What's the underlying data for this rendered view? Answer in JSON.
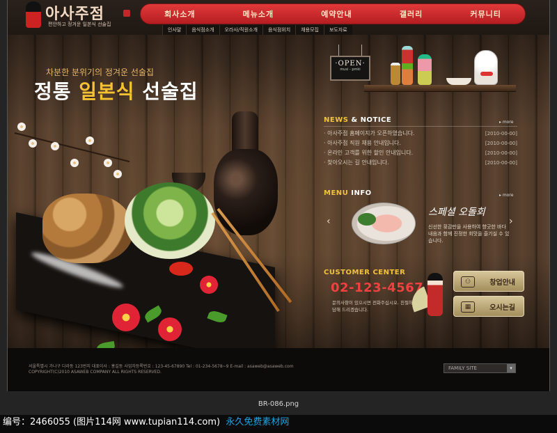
{
  "viewer": {
    "filename": "BR-086.png",
    "watermark_id": "编号：2466055 (图片114网 www.tupian114.com)",
    "watermark_tag": "永久免费素材网"
  },
  "logo": {
    "title": "아사주점",
    "subtitle": "편안하고 정겨운 일본식 선술집"
  },
  "nav": {
    "main": [
      "회사소개",
      "메뉴소개",
      "예약안내",
      "갤러리",
      "커뮤니티"
    ],
    "sub": [
      "인사말",
      "음식점소개",
      "오라사/직원소개",
      "음식점위치",
      "채용모집",
      "보도자료"
    ]
  },
  "hero": {
    "tagline": "차분한 분위기의 정겨운 선술집",
    "title_pre": "정통 ",
    "title_highlight": "일본식",
    "title_post": " 선술집"
  },
  "sign": {
    "main": "·OPEN·",
    "sub": "musi - pmki"
  },
  "news": {
    "title_a": "NEWS",
    "title_b": " & NOTICE",
    "more": "▸ more",
    "items": [
      {
        "text": "· 아사주점 홈페이지가 오픈하였습니다.",
        "date": "[2010-00-00]"
      },
      {
        "text": "· 아사주점 직원 채용 안내입니다.",
        "date": "[2010-00-00]"
      },
      {
        "text": "· 온라인 고객를 위한 할인 안내입니다.",
        "date": "[2010-00-00]"
      },
      {
        "text": "· 찾아오시는 길 안내입니다.",
        "date": "[2010-00-00]"
      }
    ]
  },
  "menu": {
    "title_a": "MENU",
    "title_b": " INFO",
    "more": "▸ more",
    "dish": "스페셜 오돌회",
    "description": "신선한 횟감만을 사용하여 향긋한 바다내음과 함께 진정한 회맛을 즐기실 수 있습니다.",
    "prev": "‹",
    "next": "›"
  },
  "customer": {
    "title": "CUSTOMER CENTER",
    "phone": "02-123-4567",
    "description": "문의사항이 있으시면 전화주십시오. 친절하게 상담해 드리겠습니다.",
    "btn_reserve": "창업안내",
    "btn_location": "오시는길"
  },
  "footer": {
    "line1": "서울특별시 가나구 다라동 123번지     대표이사 : 홍길동     사업자등록번호 : 123-45-67890     Tel : 01-234-5678~9     E-mail : asaweb@asaweb.com",
    "line2": "COPYRIGHT(C)2010 ASAWEB COMPANY ALL RIGHTS RESERVED.",
    "family_site": "FAMILY SITE",
    "family_arrow": "▾"
  }
}
